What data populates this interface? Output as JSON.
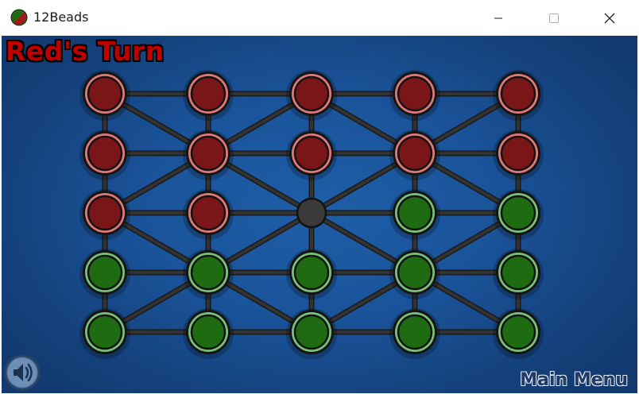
{
  "window": {
    "title": "12Beads"
  },
  "game": {
    "turn_label": "Red's Turn",
    "menu_label": "Main Menu",
    "board": [
      [
        "red",
        "red",
        "red",
        "red",
        "red"
      ],
      [
        "red",
        "red",
        "red",
        "red",
        "red"
      ],
      [
        "red",
        "red",
        "empty",
        "green",
        "green"
      ],
      [
        "green",
        "green",
        "green",
        "green",
        "green"
      ],
      [
        "green",
        "green",
        "green",
        "green",
        "green"
      ]
    ]
  },
  "colors": {
    "red": "#7a1518",
    "green": "#1e6b12",
    "empty": "#3a3a3a",
    "line": "#333333"
  },
  "icons": {
    "sound": "speaker-icon",
    "minimize": "minimize-icon",
    "maximize": "maximize-icon",
    "close": "close-icon"
  }
}
